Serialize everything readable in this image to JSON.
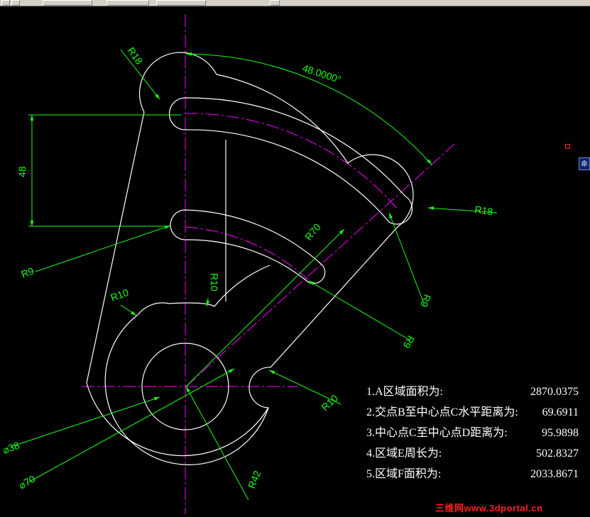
{
  "toolbar": {
    "buttons": [
      "zoom-window",
      "zoom-previous",
      "pan",
      "properties",
      "layer",
      "help"
    ]
  },
  "command_tab": {
    "label": "命"
  },
  "dimensions": {
    "r18_top": "R18",
    "angle": "48.0000°",
    "height_48": "48",
    "r18_right": "R18",
    "r70": "R70",
    "r9_left": "R9",
    "r10_mid": "R10",
    "r10_left": "R10",
    "r9_right": "R9",
    "r9_lower": "R9",
    "r10_right": "R10",
    "dia38": "⌀38",
    "dia70": "⌀70",
    "r42": "R42"
  },
  "results": [
    {
      "label": "1.A区域面积为:",
      "value": "2870.0375"
    },
    {
      "label": "2.交点B至中心点C水平距离为:",
      "value": "69.6911"
    },
    {
      "label": "3.中心点C至中心点D距离为:",
      "value": "95.9898"
    },
    {
      "label": "4.区域E周长为:",
      "value": "502.8327"
    },
    {
      "label": "5.区域F面积为:",
      "value": "2033.8671"
    }
  ],
  "watermark": "三维网www.3dportal.cn",
  "colors": {
    "background": "#000000",
    "outline": "#ffffff",
    "dimension": "#18ff18",
    "centerline": "#ff00ff",
    "watermark": "#ff2020"
  }
}
